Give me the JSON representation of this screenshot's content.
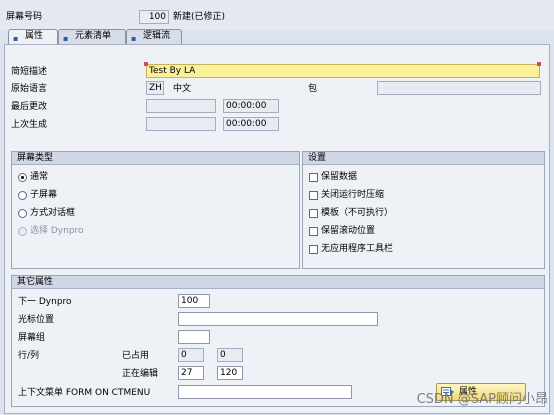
{
  "header": {
    "screen_no_label": "屏幕号码",
    "screen_no": "100",
    "status": "新建(已修正)"
  },
  "tabs": [
    {
      "label": "属性"
    },
    {
      "label": "元素清单"
    },
    {
      "label": "逻辑流"
    }
  ],
  "attributes": {
    "short_desc_label": "简短描述",
    "short_desc": "Test By LA",
    "orig_lang_label": "原始语言",
    "orig_lang_code": "ZH",
    "orig_lang_name": "中文",
    "package_label": "包",
    "package_value": "",
    "last_changed_label": "最后更改",
    "last_changed_date": "",
    "last_changed_time": "00:00:00",
    "last_generated_label": "上次生成",
    "last_generated_date": "",
    "last_generated_time": "00:00:00"
  },
  "screen_type": {
    "title": "屏幕类型",
    "options": [
      {
        "label": "通常",
        "selected": true,
        "disabled": false
      },
      {
        "label": "子屏幕",
        "selected": false,
        "disabled": false
      },
      {
        "label": "方式对话框",
        "selected": false,
        "disabled": false
      },
      {
        "label": "选择 Dynpro",
        "selected": false,
        "disabled": true
      }
    ]
  },
  "settings": {
    "title": "设置",
    "options": [
      {
        "label": "保留数据",
        "checked": false
      },
      {
        "label": "关闭运行时压缩",
        "checked": false
      },
      {
        "label": "模板（不可执行）",
        "checked": false
      },
      {
        "label": "保留滚动位置",
        "checked": false
      },
      {
        "label": "无应用程序工具栏",
        "checked": false
      }
    ]
  },
  "other": {
    "title": "其它属性",
    "next_dynpro_label": "下一 Dynpro",
    "next_dynpro": "100",
    "cursor_pos_label": "光标位置",
    "cursor_pos": "",
    "screen_group_label": "屏幕组",
    "screen_group": "",
    "rowcol_label": "行/列",
    "occupied_label": "已占用",
    "occupied_row": "0",
    "occupied_col": "0",
    "editing_label": "正在编辑",
    "editing_row": "27",
    "editing_col": "120",
    "context_menu_label": "上下文菜单 FORM ON CTMENU",
    "context_menu": "",
    "attr_button": "属性"
  },
  "watermark": "CSDN @SAP顾问小昂"
}
